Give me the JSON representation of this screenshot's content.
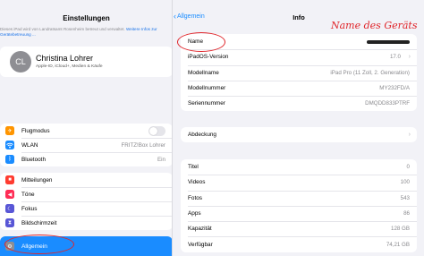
{
  "sidebar": {
    "title": "Einstellungen",
    "note": "Dieses iPad wird von Landratsamt Rosenheim betreut und verwaltet.",
    "note_link": "Weitere Infos zur Gerätebetreuung ...",
    "profile": {
      "initials": "CL",
      "name": "Christina Lohrer",
      "subtitle": "Apple-ID, iCloud+, Medien & Käufe"
    },
    "group1": [
      {
        "label": "Flugmodus",
        "icon": "airplane-icon",
        "color": "#ff9500"
      },
      {
        "label": "WLAN",
        "icon": "wifi-icon",
        "color": "#1a8cff",
        "value": "FRITZ!Box Lohrer"
      },
      {
        "label": "Bluetooth",
        "icon": "bluetooth-icon",
        "color": "#1a8cff",
        "value": "Ein"
      }
    ],
    "group2": [
      {
        "label": "Mitteilungen",
        "icon": "notifications-icon",
        "color": "#ff3b30"
      },
      {
        "label": "Töne",
        "icon": "sound-icon",
        "color": "#ff2d55"
      },
      {
        "label": "Fokus",
        "icon": "moon-icon",
        "color": "#5856d6"
      },
      {
        "label": "Bildschirmzeit",
        "icon": "hourglass-icon",
        "color": "#5856d6"
      }
    ],
    "selected": "Allgemein"
  },
  "nav": {
    "back_label": "Allgemein",
    "title": "Info"
  },
  "card1": [
    {
      "label": "Name",
      "value": ""
    },
    {
      "label": "iPadOS-Version",
      "value": "17.0"
    },
    {
      "label": "Modellname",
      "value": "iPad Pro (11 Zoll, 2. Generation)"
    },
    {
      "label": "Modellnummer",
      "value": "MY232FD/A"
    },
    {
      "label": "Seriennummer",
      "value": "DMQDD833PTRF"
    }
  ],
  "card2": [
    {
      "label": "Abdeckung"
    }
  ],
  "card3": [
    {
      "label": "Titel",
      "value": "0"
    },
    {
      "label": "Videos",
      "value": "100"
    },
    {
      "label": "Fotos",
      "value": "543"
    },
    {
      "label": "Apps",
      "value": "86"
    },
    {
      "label": "Kapazität",
      "value": "128 GB"
    },
    {
      "label": "Verfügbar",
      "value": "74,21 GB"
    }
  ],
  "annotation": {
    "text": "Name des Geräts",
    "color": "#e0252a"
  }
}
